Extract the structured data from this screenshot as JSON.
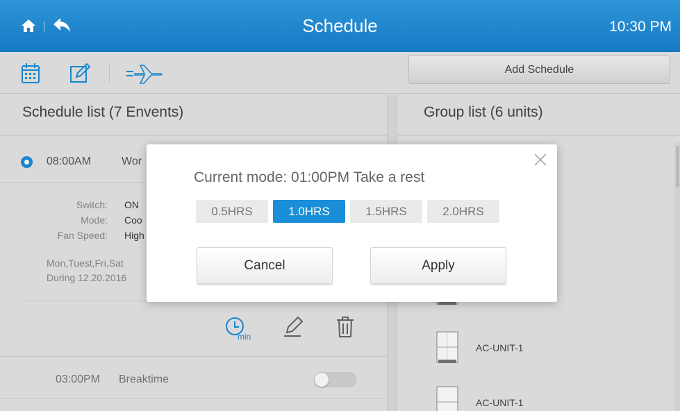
{
  "header": {
    "title": "Schedule",
    "time": "10:30 PM"
  },
  "toolbar": {
    "add_schedule_label": "Add Schedule"
  },
  "schedule_list": {
    "title": "Schedule list (7 Envents)",
    "events": [
      {
        "time": "08:00AM",
        "name": "Wor",
        "details": {
          "switch_label": "Switch:",
          "switch_value": "ON",
          "mode_label": "Mode:",
          "mode_value": "Coo",
          "fan_label": "Fan Speed:",
          "fan_value": "High",
          "days": "Mon,Tuest,Fri,Sat",
          "during": "During 12.20.2016"
        }
      },
      {
        "time": "03:00PM",
        "name": "Breaktime"
      }
    ]
  },
  "group_list": {
    "title": "Group list (6 units)",
    "units": [
      "AC-UNIT-1",
      "AC-UNIT-1"
    ]
  },
  "dialog": {
    "mode_text": "Current mode:   01:00PM  Take a rest",
    "options": [
      "0.5HRS",
      "1.0HRS",
      "1.5HRS",
      "2.0HRS"
    ],
    "selected_index": 1,
    "cancel_label": "Cancel",
    "apply_label": "Apply"
  },
  "timer_icon_label": "min",
  "colors": {
    "accent": "#1a8ed8",
    "header": "#1f86cc"
  }
}
